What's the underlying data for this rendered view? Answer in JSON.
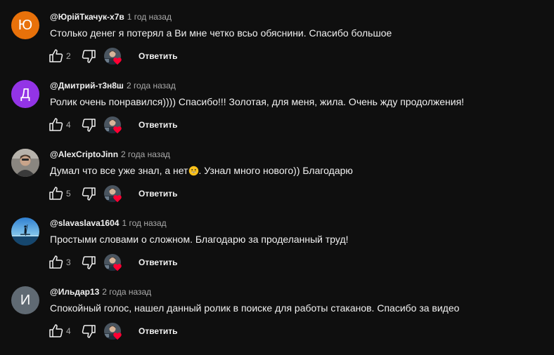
{
  "reply_label": "Ответить",
  "colors": {
    "background": "#0f0f0f",
    "text": "#f1f1f1",
    "muted": "#aaaaaa",
    "heart": "#ff0033"
  },
  "comments": [
    {
      "author": "@ЮрійТкачук-х7в",
      "time": "1 год назад",
      "text": "Столько денег я потерял а Ви мне четко всьо обяснини. Спасибо большое",
      "likes": "2",
      "avatar_letter": "Ю",
      "avatar_color": "#e8710a"
    },
    {
      "author": "@Дмитрий-т3н8ш",
      "time": "2 года назад",
      "text": "Ролик очень понравился)))) Спасибо!!! Золотая, для меня, жила. Очень жду продолжения!",
      "likes": "4",
      "avatar_letter": "Д",
      "avatar_color": "#9334e6"
    },
    {
      "author": "@AlexCriptoJinn",
      "time": "2 года назад",
      "text_before": "Думал что все уже знал, а нет",
      "text_after": ".  Узнал много нового)) Благодарю",
      "likes": "5",
      "avatar_icon": "person-photo-icon",
      "emoji_icon": "grinning-face-emoji-icon"
    },
    {
      "author": "@slavaslava1604",
      "time": "1 год назад",
      "text": "Простыми словами о сложном. Благодарю за проделанный труд!",
      "likes": "3",
      "avatar_icon": "paddleboard-sunset-icon"
    },
    {
      "author": "@Ильдар13",
      "time": "2 года назад",
      "text": "Спокойный голос, нашел данный ролик в поиске для работы стаканов. Спасибо за видео",
      "likes": "4",
      "avatar_letter": "И",
      "avatar_color": "#606a73"
    }
  ]
}
